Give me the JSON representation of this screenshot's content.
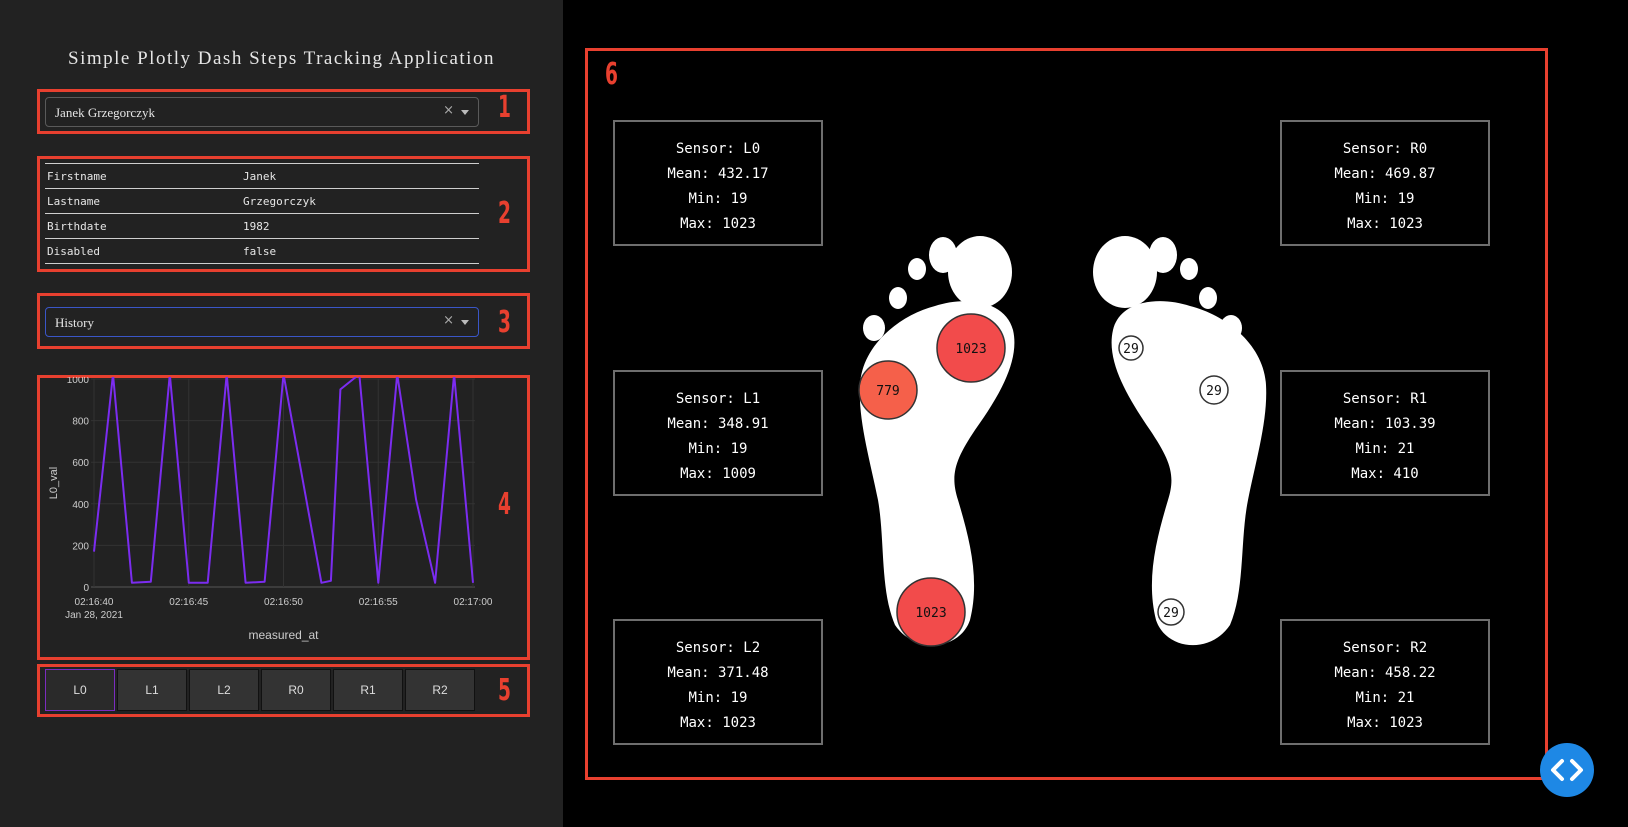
{
  "app_title": "Simple Plotly Dash Steps Tracking Application",
  "badges": [
    "1",
    "2",
    "3",
    "4",
    "5",
    "6"
  ],
  "person_dropdown": {
    "value": "Janek Grzegorczyk",
    "clear_glyph": "×"
  },
  "person_table": [
    {
      "key": "Firstname",
      "value": "Janek"
    },
    {
      "key": "Lastname",
      "value": "Grzegorczyk"
    },
    {
      "key": "Birthdate",
      "value": "1982"
    },
    {
      "key": "Disabled",
      "value": "false"
    }
  ],
  "mode_dropdown": {
    "value": "History",
    "clear_glyph": "×"
  },
  "chart_data": {
    "type": "line",
    "xlabel": "measured_at",
    "ylabel": "L0_val",
    "ylim": [
      0,
      1000
    ],
    "yticks": [
      0,
      200,
      400,
      600,
      800,
      1000
    ],
    "xticks": [
      "02:16:40",
      "02:16:45",
      "02:16:50",
      "02:16:55",
      "02:17:00"
    ],
    "xtick_date": "Jan 28, 2021",
    "series": [
      {
        "color": "#7b2cf0",
        "x": [
          "02:16:40.0",
          "02:16:41.0",
          "02:16:42.0",
          "02:16:43.0",
          "02:16:44.0",
          "02:16:45.0",
          "02:16:46.0",
          "02:16:47.0",
          "02:16:48.0",
          "02:16:49.0",
          "02:16:50.0",
          "02:16:52.0",
          "02:16:52.5",
          "02:16:53.0",
          "02:16:54.0",
          "02:16:55.0",
          "02:16:56.0",
          "02:16:57.0",
          "02:16:58.0",
          "02:16:59.0",
          "02:17:00.0"
        ],
        "y": [
          170,
          1023,
          20,
          25,
          1023,
          20,
          20,
          1023,
          20,
          25,
          1023,
          20,
          30,
          950,
          1023,
          20,
          1023,
          420,
          20,
          1023,
          20
        ]
      }
    ]
  },
  "sensor_buttons": [
    "L0",
    "L1",
    "L2",
    "R0",
    "R1",
    "R2"
  ],
  "active_sensor": "L0",
  "sensor_stats": [
    {
      "sensor": "Sensor: L0",
      "mean": "Mean: 432.17",
      "min": "Min: 19",
      "max": "Max: 1023"
    },
    {
      "sensor": "Sensor: L1",
      "mean": "Mean: 348.91",
      "min": "Min: 19",
      "max": "Max: 1009"
    },
    {
      "sensor": "Sensor: L2",
      "mean": "Mean: 371.48",
      "min": "Min: 19",
      "max": "Max: 1023"
    },
    {
      "sensor": "Sensor: R0",
      "mean": "Mean: 469.87",
      "min": "Min: 19",
      "max": "Max: 1023"
    },
    {
      "sensor": "Sensor: R1",
      "mean": "Mean: 103.39",
      "min": "Min: 21",
      "max": "Max: 410"
    },
    {
      "sensor": "Sensor: R2",
      "mean": "Mean: 458.22",
      "min": "Min: 21",
      "max": "Max: 1023"
    }
  ],
  "foot_readings": {
    "L0": {
      "value": "1023",
      "color": "#f24b4b"
    },
    "L1": {
      "value": "779",
      "color": "#f5604a"
    },
    "L2": {
      "value": "1023",
      "color": "#f24b4b"
    },
    "R0": {
      "value": "29",
      "color": "#ffffff"
    },
    "R1": {
      "value": "29",
      "color": "#ffffff"
    },
    "R2": {
      "value": "29",
      "color": "#ffffff"
    }
  },
  "colors": {
    "accent_red": "#e8402f",
    "panel_bg": "#222222",
    "line": "#7b2cf0",
    "fab": "#1e88e5"
  },
  "icons": {
    "code_button": "code-brackets-icon"
  }
}
